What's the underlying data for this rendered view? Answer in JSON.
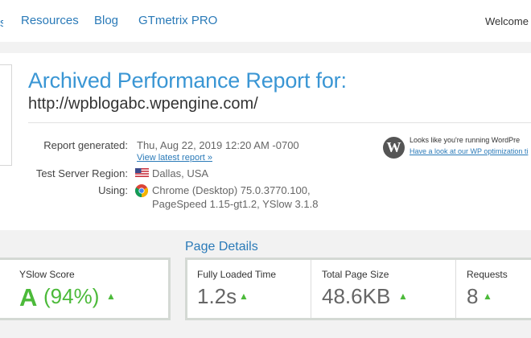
{
  "nav": {
    "links": [
      "Resources",
      "Blog",
      "GTmetrix PRO"
    ],
    "welcome": "Welcome N"
  },
  "report": {
    "title": "Archived Performance Report for:",
    "url": "http://wpblogabc.wpengine.com/",
    "generated_label": "Report generated:",
    "generated_value": "Thu, Aug 22, 2019 12:20 AM -0700",
    "latest_link": "View latest report »",
    "region_label": "Test Server Region:",
    "region_value": "Dallas, USA",
    "using_label": "Using:",
    "using_line1": "Chrome (Desktop) 75.0.3770.100,",
    "using_line2": "PageSpeed 1.15-gt1.2, YSlow 3.1.8"
  },
  "wordpress": {
    "notice": "Looks like you're running WordPre",
    "link": "Have a look at our WP optimization ti"
  },
  "scores": {
    "page_details_heading": "Page Details",
    "yslow_label": "YSlow Score",
    "yslow_grade": "A",
    "yslow_pct": "(94%)",
    "fully_loaded_label": "Fully Loaded Time",
    "fully_loaded_value": "1.2s",
    "page_size_label": "Total Page Size",
    "page_size_value": "48.6KB",
    "requests_label": "Requests",
    "requests_value": "8"
  },
  "colors": {
    "accent_blue": "#3a96d4",
    "link_blue": "#2a7ab8",
    "grade_green": "#4cba3a"
  },
  "icons": [
    "us-flag-icon",
    "chrome-icon",
    "wordpress-icon",
    "caret-up-icon"
  ]
}
